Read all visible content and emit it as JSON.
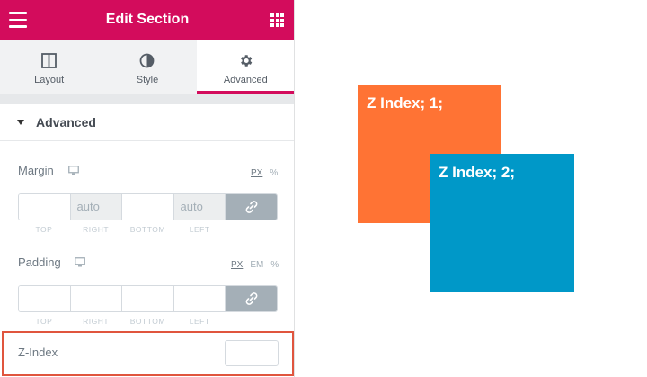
{
  "header": {
    "title": "Edit Section",
    "menu_icon": "hamburger-icon",
    "apps_icon": "grid-icon"
  },
  "tabs": [
    {
      "label": "Layout",
      "icon": "layout-columns-icon",
      "active": false
    },
    {
      "label": "Style",
      "icon": "half-circle-icon",
      "active": false
    },
    {
      "label": "Advanced",
      "icon": "gear-icon",
      "active": true
    }
  ],
  "section": {
    "title": "Advanced"
  },
  "margin": {
    "label": "Margin",
    "units": [
      "PX",
      "%"
    ],
    "active_unit": "PX",
    "values": {
      "top": "",
      "right": "auto",
      "bottom": "",
      "left": "auto"
    },
    "sublabels": [
      "TOP",
      "RIGHT",
      "BOTTOM",
      "LEFT"
    ]
  },
  "padding": {
    "label": "Padding",
    "units": [
      "PX",
      "EM",
      "%"
    ],
    "active_unit": "PX",
    "values": {
      "top": "",
      "right": "",
      "bottom": "",
      "left": ""
    },
    "sublabels": [
      "TOP",
      "RIGHT",
      "BOTTOM",
      "LEFT"
    ]
  },
  "zindex": {
    "label": "Z-Index",
    "value": ""
  },
  "demo": {
    "box1": {
      "text": "Z Index; 1;",
      "color": "#ff7334"
    },
    "box2": {
      "text": "Z Index; 2;",
      "color": "#0098c8"
    }
  },
  "colors": {
    "accent": "#d30c5c",
    "highlight": "#e0553e"
  }
}
